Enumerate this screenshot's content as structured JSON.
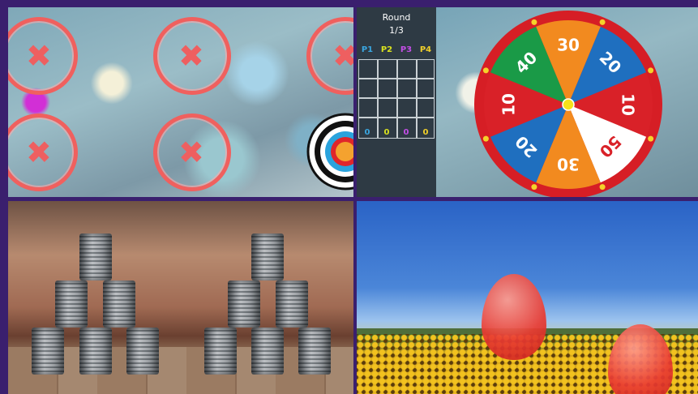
{
  "panels": {
    "top_left": {
      "name": "target-shooting"
    },
    "top_right": {
      "name": "prize-wheel"
    },
    "bottom_left": {
      "name": "can-knockdown"
    },
    "bottom_right": {
      "name": "balloon-pop"
    }
  },
  "scoreboard": {
    "title": "Round",
    "round": "1/3",
    "players": [
      {
        "label": "P1",
        "color": "#3aa6e0",
        "score": "0"
      },
      {
        "label": "P2",
        "color": "#d9e21f",
        "score": "0"
      },
      {
        "label": "P3",
        "color": "#c34ee6",
        "score": "0"
      },
      {
        "label": "P4",
        "color": "#f0cf2a",
        "score": "0"
      }
    ]
  },
  "wheel": {
    "segments": [
      {
        "value": "20",
        "color": "#1f6fbf"
      },
      {
        "value": "10",
        "color": "#d92128"
      },
      {
        "value": "50",
        "color": "#ffffff",
        "text_color": "#d92128"
      },
      {
        "value": "30",
        "color": "#f28a1f"
      },
      {
        "value": "20",
        "color": "#1f6fbf"
      },
      {
        "value": "10",
        "color": "#d92128"
      },
      {
        "value": "40",
        "color": "#1a9a47"
      },
      {
        "value": "30",
        "color": "#f28a1f"
      }
    ],
    "rim_color": "#d61e25"
  },
  "icons": {
    "miss_marker": "x-mark-icon",
    "bullseye": "bullseye-target-icon"
  }
}
